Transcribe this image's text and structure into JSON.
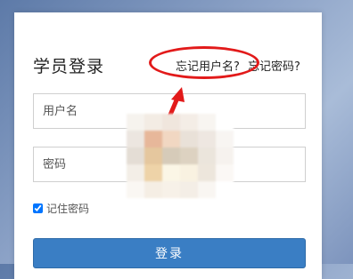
{
  "login": {
    "title": "学员登录",
    "forgot_username": "忘记用户名?",
    "forgot_password": "忘记密码?",
    "username_placeholder": "用户名",
    "password_placeholder": "密码",
    "remember_label": "记住密码",
    "remember_checked": true,
    "submit_label": "登录"
  },
  "annotation": {
    "color": "#e21a1a"
  },
  "colors": {
    "primary_button": "#3a7ec4",
    "panel": "#ffffff"
  }
}
